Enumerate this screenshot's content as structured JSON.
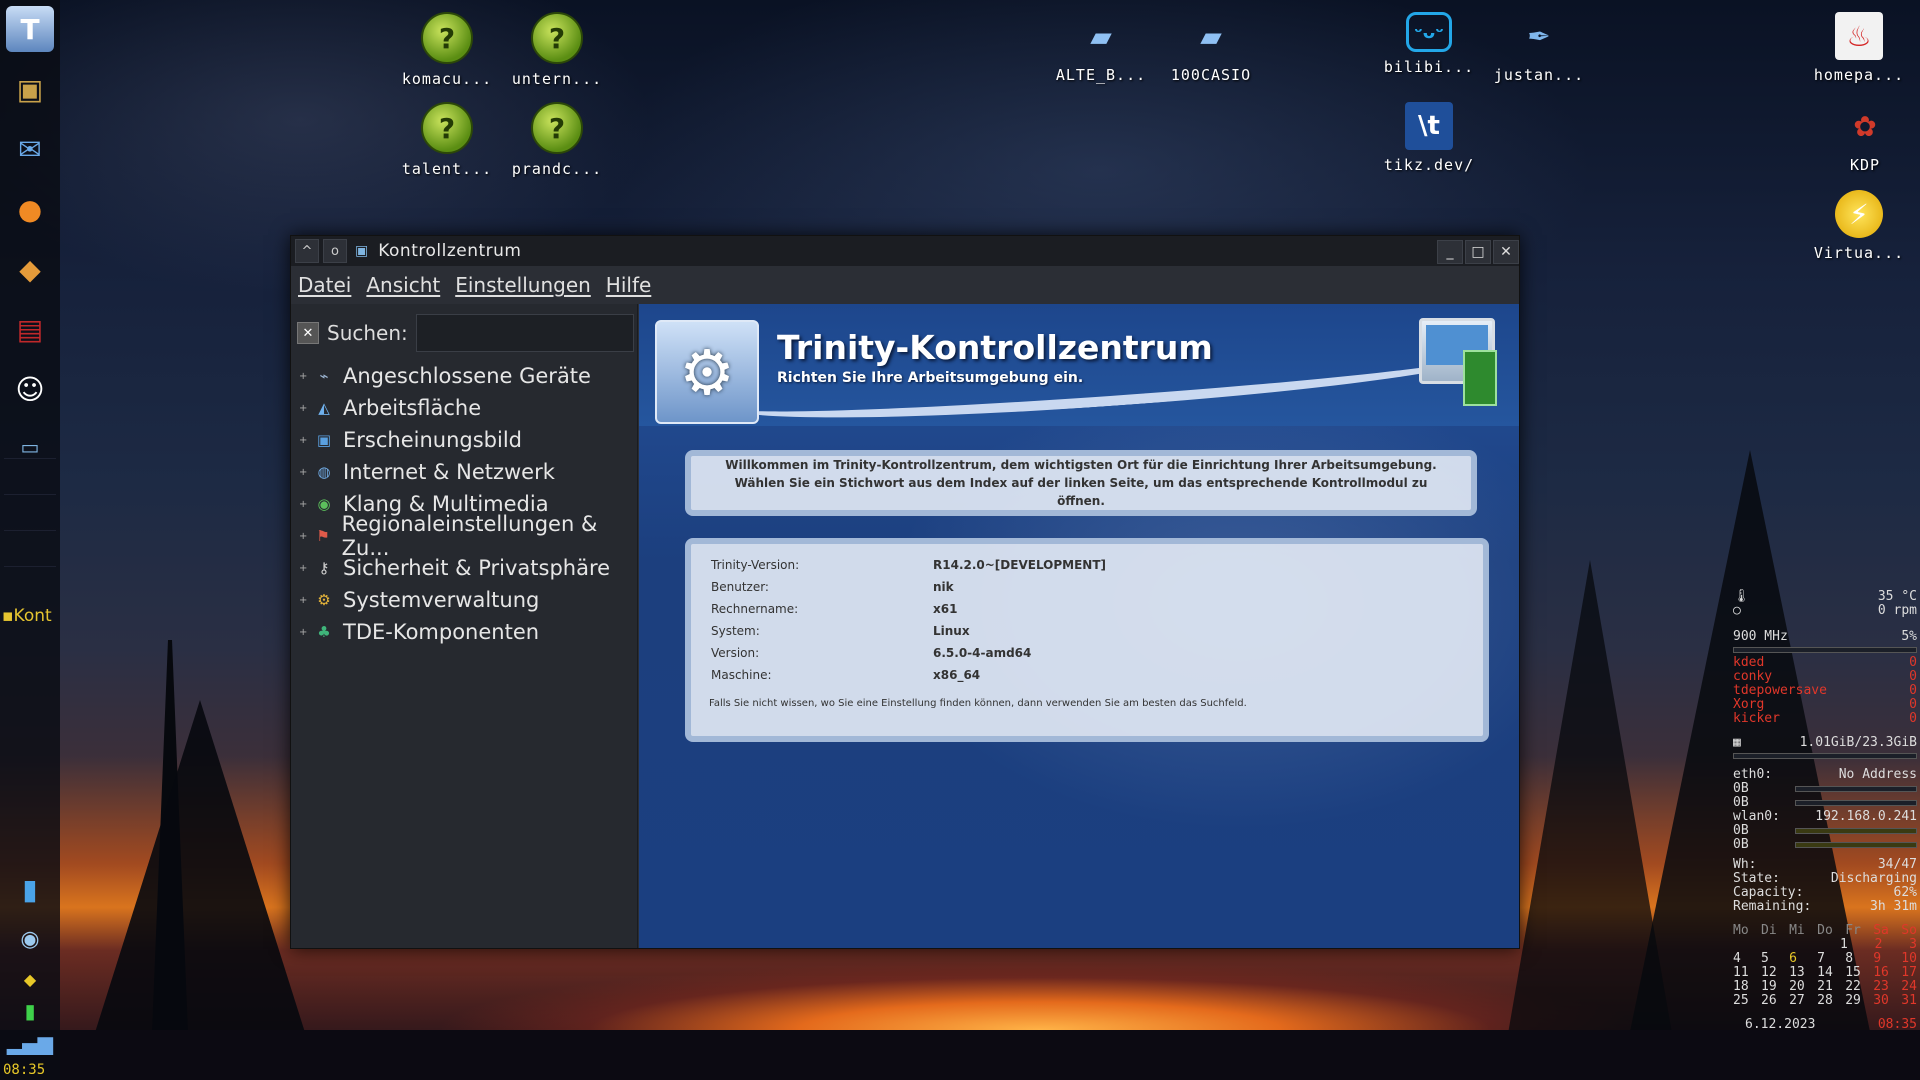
{
  "kicker": {
    "task_label": "Kont",
    "clock": "08:35"
  },
  "desktop_icons": [
    {
      "label": "komacu...",
      "icon": "question-globe-icon"
    },
    {
      "label": "untern...",
      "icon": "question-globe-icon"
    },
    {
      "label": "talent...",
      "icon": "question-globe-icon"
    },
    {
      "label": "prandc...",
      "icon": "question-globe-icon"
    },
    {
      "label": "ALTE_B...",
      "icon": "folder-icon"
    },
    {
      "label": "100CASIO",
      "icon": "folder-icon"
    },
    {
      "label": "bilibi...",
      "icon": "bilibili-icon"
    },
    {
      "label": "justan...",
      "icon": "feather-icon"
    },
    {
      "label": "tikz.dev/",
      "icon": "tikz-icon"
    },
    {
      "label": "homepa...",
      "icon": "homepage-icon"
    },
    {
      "label": "KDP",
      "icon": "kdp-icon"
    },
    {
      "label": "Virtua...",
      "icon": "lightning-icon"
    }
  ],
  "window": {
    "title": "Kontrollzentrum",
    "menu": [
      "Datei",
      "Ansicht",
      "Einstellungen",
      "Hilfe"
    ],
    "search_label": "Suchen:",
    "search_value": "",
    "tree": [
      "Angeschlossene Geräte",
      "Arbeitsfläche",
      "Erscheinungsbild",
      "Internet & Netzwerk",
      "Klang & Multimedia",
      "Regionaleinstellungen & Zu...",
      "Sicherheit & Privatsphäre",
      "Systemverwaltung",
      "TDE-Komponenten"
    ],
    "banner_title": "Trinity-Kontrollzentrum",
    "banner_subtitle": "Richten Sie Ihre Arbeitsumgebung ein.",
    "welcome": "Willkommen im Trinity-Kontrollzentrum, dem wichtigsten Ort für die Einrichtung Ihrer Arbeitsumgebung. Wählen Sie ein Stichwort aus dem Index auf der linken Seite, um das entsprechende Kontrollmodul zu öffnen.",
    "info": [
      {
        "key": "Trinity-Version:",
        "value": "R14.2.0~[DEVELOPMENT]"
      },
      {
        "key": "Benutzer:",
        "value": "nik"
      },
      {
        "key": "Rechnername:",
        "value": "x61"
      },
      {
        "key": "System:",
        "value": "Linux"
      },
      {
        "key": "Version:",
        "value": "6.5.0-4-amd64"
      },
      {
        "key": "Maschine:",
        "value": "x86_64"
      }
    ],
    "hint": "Falls Sie nicht wissen, wo Sie eine Einstellung finden können, dann verwenden Sie am besten das Suchfeld."
  },
  "conky": {
    "temp": "35  °C",
    "fan": "0 rpm",
    "cpu_freq": "900 MHz",
    "cpu_pct": "5%",
    "procs": [
      {
        "name": "kded",
        "val": "0"
      },
      {
        "name": "conky",
        "val": "0"
      },
      {
        "name": "tdepowersave",
        "val": "0"
      },
      {
        "name": "Xorg",
        "val": "0"
      },
      {
        "name": "kicker",
        "val": "0"
      }
    ],
    "mem": "1.01GiB/23.3GiB",
    "eth0_label": "eth0:",
    "eth0_addr": "No Address",
    "eth0_down": "0B",
    "eth0_up": "0B",
    "wlan0_label": "wlan0:",
    "wlan0_addr": "192.168.0.241",
    "wlan0_down": "0B",
    "wlan0_up": "0B",
    "bat_wh_label": "Wh:",
    "bat_wh": "34/47",
    "bat_state_label": "State:",
    "bat_state": "Discharging",
    "bat_cap_label": "Capacity:",
    "bat_cap": "62%",
    "bat_rem_label": "Remaining:",
    "bat_rem": "3h 31m",
    "cal_header": [
      "Mo",
      "Di",
      "Mi",
      "Do",
      "Fr",
      "Sa",
      "So"
    ],
    "cal_rows": [
      [
        "",
        "",
        "",
        "",
        "1",
        "2",
        "3"
      ],
      [
        "4",
        "5",
        "6",
        "7",
        "8",
        "9",
        "10"
      ],
      [
        "11",
        "12",
        "13",
        "14",
        "15",
        "16",
        "17"
      ],
      [
        "18",
        "19",
        "20",
        "21",
        "22",
        "23",
        "24"
      ],
      [
        "25",
        "26",
        "27",
        "28",
        "29",
        "30",
        "31"
      ]
    ],
    "date": "6.12.2023",
    "time": "08:35"
  }
}
